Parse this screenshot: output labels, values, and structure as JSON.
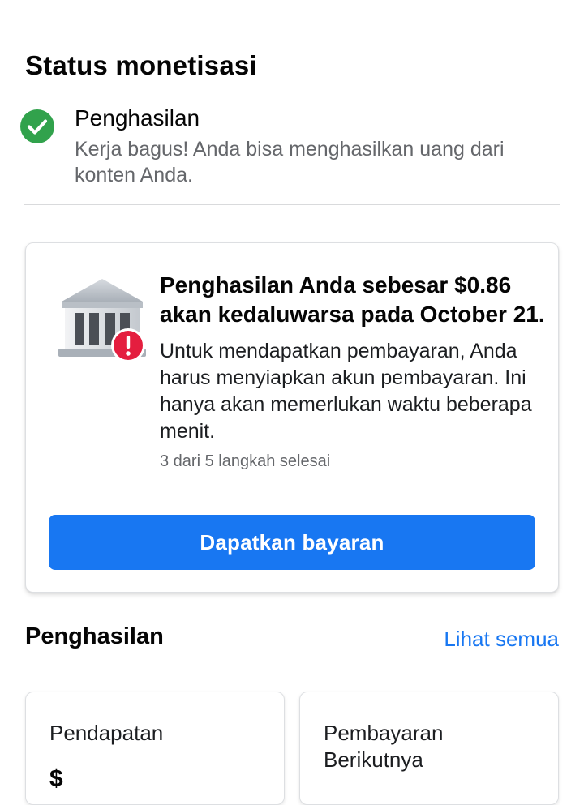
{
  "monetization_status": {
    "title": "Status monetisasi",
    "status_title": "Penghasilan",
    "status_description": "Kerja bagus! Anda bisa menghasilkan uang dari konten Anda.",
    "status_icon": "check-circle-icon",
    "status_color": "#31a24c"
  },
  "payout_card": {
    "icon": "bank-icon",
    "alert_icon": "alert-icon",
    "alert_color": "#e41e3f",
    "headline": "Penghasilan Anda sebesar $0.86 akan kedaluwarsa pada October 21.",
    "body": "Untuk mendapatkan pembayaran, Anda harus menyiapkan akun pembayaran. Ini hanya akan memerlukan waktu beberapa menit.",
    "progress_text": "3 dari 5 langkah selesai",
    "button_label": "Dapatkan bayaran",
    "button_color": "#1877f2"
  },
  "earnings": {
    "title": "Penghasilan",
    "see_all_label": "Lihat semua",
    "cards": [
      {
        "label": "Pendapatan",
        "value": "$"
      },
      {
        "label": "Pembayaran Berikutnya",
        "value": ""
      }
    ]
  }
}
